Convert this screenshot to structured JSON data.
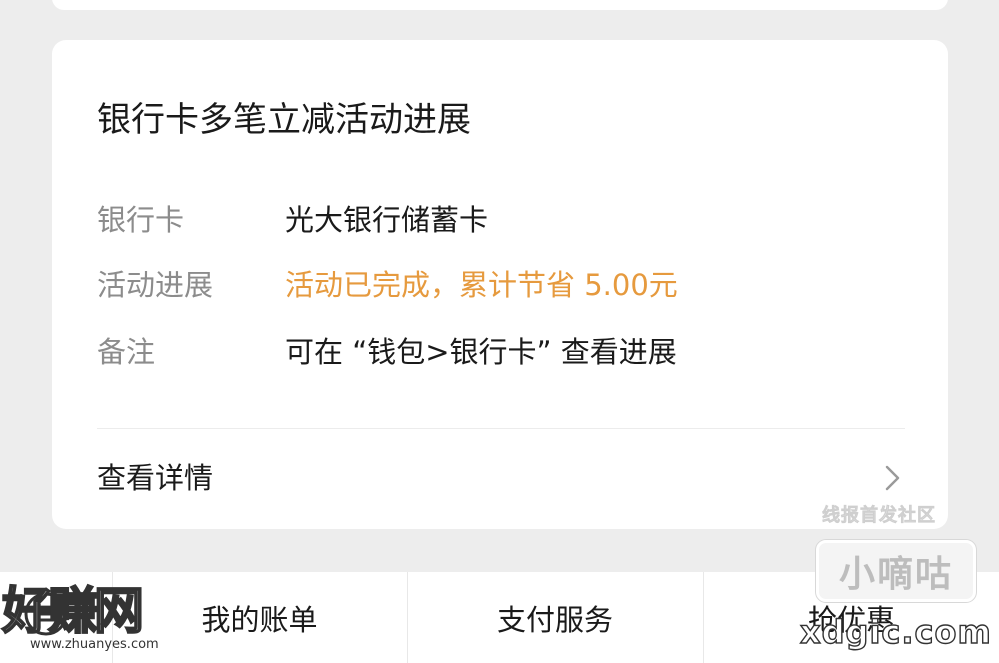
{
  "card": {
    "title": "银行卡多笔立减活动进展",
    "rows": [
      {
        "label": "银行卡",
        "value": "光大银行储蓄卡"
      },
      {
        "label": "活动进展",
        "value": "活动已完成，累计节省 5.00元"
      },
      {
        "label": "备注",
        "value": "可在 “钱包>银行卡” 查看进展"
      }
    ],
    "details_label": "查看详情"
  },
  "bottom_bar": {
    "tabs": [
      {
        "label": "我的账单"
      },
      {
        "label": "支付服务"
      },
      {
        "label": "抢优惠"
      }
    ]
  },
  "watermarks": {
    "left_text": "好赚网",
    "left_url": "www.zhuanyes.com",
    "right_top": "线报首发社区",
    "right_box": "小嘀咕",
    "right_domain": "xdgic.com"
  },
  "colors": {
    "background": "#ededed",
    "card": "#ffffff",
    "highlight": "#e69a3e",
    "label": "#8c8c8c",
    "text": "#1a1a1a"
  },
  "icons": {
    "details_chevron": "chevron-right-icon",
    "menu": "menu-list-icon"
  }
}
